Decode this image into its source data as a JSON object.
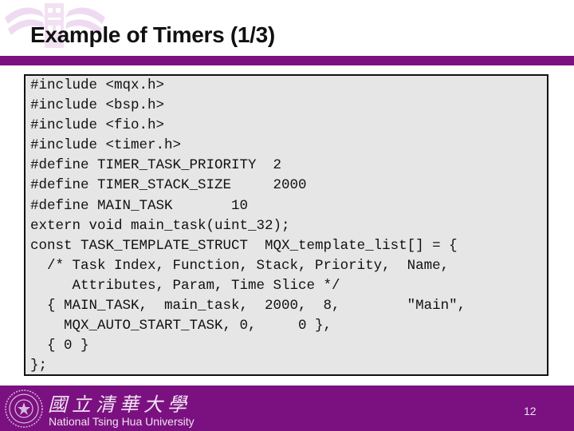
{
  "slide": {
    "title": "Example of Timers (1/3)",
    "code_lines": [
      "#include <mqx.h>",
      "#include <bsp.h>",
      "#include <fio.h>",
      "#include <timer.h>",
      "#define TIMER_TASK_PRIORITY  2",
      "#define TIMER_STACK_SIZE     2000",
      "#define MAIN_TASK       10",
      "extern void main_task(uint_32);",
      "const TASK_TEMPLATE_STRUCT  MQX_template_list[] = {",
      "  /* Task Index, Function, Stack, Priority,  Name,",
      "     Attributes, Param, Time Slice */",
      "  { MAIN_TASK,  main_task,  2000,  8,        \"Main\",",
      "    MQX_AUTO_START_TASK, 0,     0 },",
      "  { 0 }",
      "};"
    ]
  },
  "footer": {
    "university_cn": "國立清華大學",
    "university_en": "National Tsing Hua University",
    "page_number": "12"
  },
  "colors": {
    "brand_purple": "#7b1180",
    "code_background": "#e6e6e6"
  }
}
